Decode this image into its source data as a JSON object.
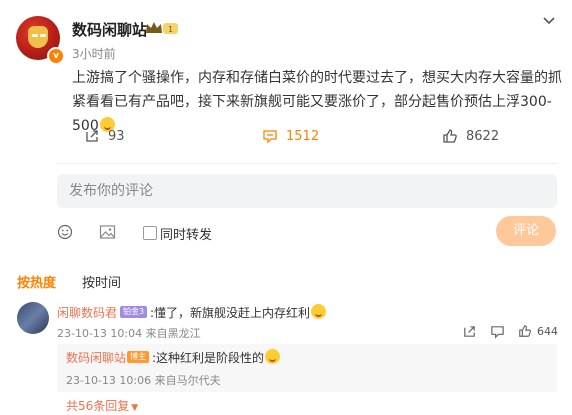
{
  "post": {
    "author": "数码闲聊站",
    "rank_badge": "1",
    "verified_mark": "v",
    "time": "3小时前",
    "content": "上游搞了个骚操作，内存和存储白菜价的时代要过去了，想买大内存大容量的抓紧看看已有产品吧，接下来新旗舰可能又要涨价了，部分起售价预估上浮300-500",
    "actions": {
      "forward_count": "93",
      "comment_count": "1512",
      "like_count": "8622"
    },
    "accent_color": "#ff8200"
  },
  "comment_box": {
    "placeholder": "发布你的评论",
    "forward_label": "同时转发",
    "submit_label": "评论"
  },
  "tabs": {
    "hot": "按热度",
    "time": "按时间"
  },
  "comments": [
    {
      "user": "闲聊数码君",
      "level_badge": "铂金3",
      "text": ":懂了，新旗舰没赶上内存红利",
      "meta": "23-10-13 10:04 来自黑龙江",
      "like_count": "644",
      "reply": {
        "user": "数码闲聊站",
        "badge": "博主",
        "text": ":这种红利是阶段性的",
        "meta": "23-10-13 10:06 来自马尔代夫"
      },
      "more_replies": "共56条回复"
    }
  ]
}
